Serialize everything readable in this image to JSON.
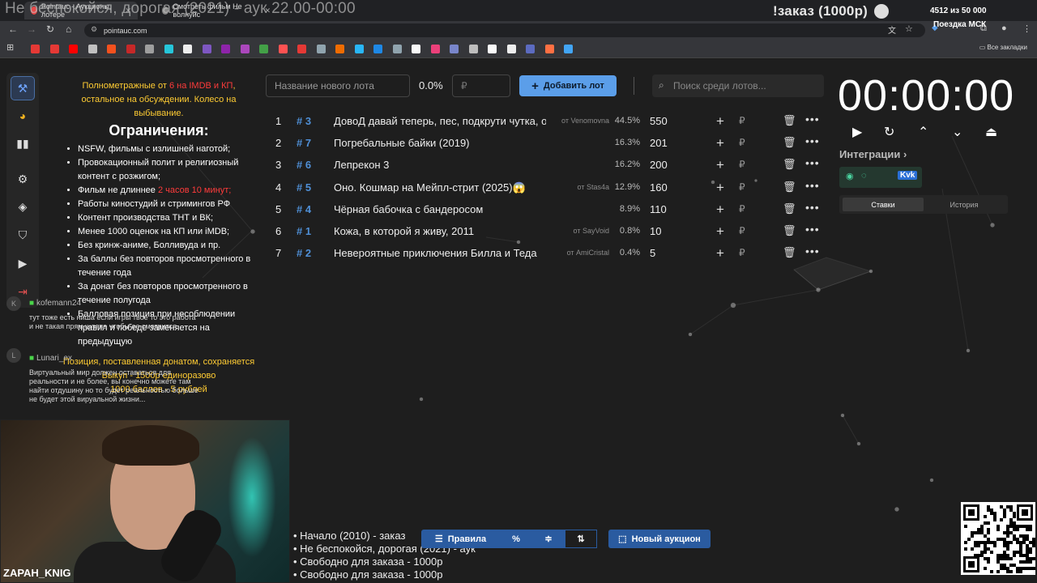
{
  "browser": {
    "overlay_title": "Не беспокойся, дорогая (2021) - аук 22.00-00:00",
    "tabs": [
      {
        "label": "Pointauc - Аукционы, лотере"
      },
      {
        "label": "Смотреть фильм Не волнуйс"
      }
    ],
    "url": "pointauc.com",
    "all_bookmarks": "Все закладки"
  },
  "stream_overlay": {
    "order_title": "!заказ (1000р)",
    "order_count": "4512  из 50 000",
    "order_sub": "Поездка МСК",
    "webcam_name": "ZAPAH_KNIG",
    "playlist": [
      "• Начало (2010) - заказ",
      "• Не беспокойся, дорогая (2021) - аук",
      "• Свободно для заказа - 1000р",
      "• Свободно для заказа - 1000р"
    ]
  },
  "rules": {
    "head_part1": "Полнометражные от ",
    "head_red": "6 на IMDB и КП",
    "head_part2": ", остальное на обсуждении. Колесо на выбывание.",
    "title": "Ограничения:",
    "items": [
      "NSFW, фильмы с излишней наготой;",
      "Провокационный полит и религиозный контент с розжигом;",
      "Фильм не длиннее ",
      "Работы киностудий и стримингов РФ",
      "Контент производства ТНТ и ВК;",
      "Менее 1000 оценок на КП или iMDB;",
      "Без кринж-аниме, Болливуда и пр.",
      "За баллы без повторов просмотренного в течение года",
      "За донат без повторов просмотренного в течение полугода",
      "Балловая позиция при несоблюдении правил и победе заменяется на предыдущую"
    ],
    "item3_red": "2 часов 10 минут;",
    "foot1": "Позиция, поставленная донатом, сохраняется",
    "foot2": "Выкуп - 1500р единоразово",
    "foot3": "1000 баллов - 5 рублей"
  },
  "chat": [
    {
      "avatar": "K",
      "name": "kofemann24",
      "message": "тут тоже есть ниша если игры твое то это работа и не такая прям шляпа чтобы ее смотрится"
    },
    {
      "avatar": "L",
      "name": "Lunari_ex",
      "message": "Виртуальный мир должен оставаться для реальности и не более, вы конечно можете там найти отдушину но то будет реальностью больше не будет этой вируальной жизни..."
    }
  ],
  "toolbar": {
    "lot_placeholder": "Название нового лота",
    "percent": "0.0%",
    "rub_placeholder": "₽",
    "add_label": "Добавить лот",
    "search_placeholder": "Поиск среди лотов..."
  },
  "lots": [
    {
      "n": "1",
      "hash": "# 3",
      "name": "ДовоД давай теперь, пес, подкрути чутка, о",
      "from": "от Venomovna",
      "pct": "44.5%",
      "amount": "550"
    },
    {
      "n": "2",
      "hash": "# 7",
      "name": "Погребальные байки (2019)",
      "from": "",
      "pct": "16.3%",
      "amount": "201"
    },
    {
      "n": "3",
      "hash": "# 6",
      "name": "Лепрекон 3",
      "from": "",
      "pct": "16.2%",
      "amount": "200"
    },
    {
      "n": "4",
      "hash": "# 5",
      "name": "Оно. Кошмар на Мейпл-стрит (2025)😱",
      "from": "от Stas4a",
      "pct": "12.9%",
      "amount": "160"
    },
    {
      "n": "5",
      "hash": "# 4",
      "name": "Чёрная бабочка с бандеросом",
      "from": "",
      "pct": "8.9%",
      "amount": "110"
    },
    {
      "n": "6",
      "hash": "# 1",
      "name": "Кожа, в которой я живу, 2011",
      "from": "от SayVoid",
      "pct": "0.8%",
      "amount": "10"
    },
    {
      "n": "7",
      "hash": "# 2",
      "name": "Невероятные приключения Билла и Теда",
      "from": "от AmiCristal",
      "pct": "0.4%",
      "amount": "5"
    }
  ],
  "timer": {
    "display": "00:00:00",
    "integrations": "Интеграции",
    "tab_bets": "Ставки",
    "tab_history": "История"
  },
  "bottom": {
    "rules_label": "Правила",
    "new_auction": "Новый аукцион"
  },
  "colors": {
    "accent": "#5b9ee9",
    "hash_blue": "#4f8fd6",
    "rules_yellow": "#ffcc33",
    "rules_red": "#ff3b3b"
  }
}
